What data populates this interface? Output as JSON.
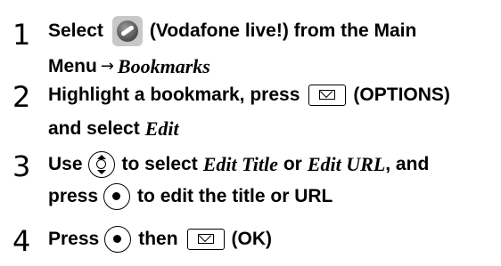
{
  "steps": [
    {
      "number": "1",
      "line1": {
        "a": "Select",
        "b": "(Vodafone live!) from the Main"
      },
      "line2": {
        "a": "Menu",
        "arrow": "→",
        "b": "Bookmarks"
      },
      "icon": "vodafone-live-icon"
    },
    {
      "number": "2",
      "line1": {
        "a": "Highlight a bookmark, press",
        "b": "(OPTIONS)"
      },
      "line2": {
        "a": "and select",
        "b": "Edit"
      },
      "icon": "mail-key-icon"
    },
    {
      "number": "3",
      "line1": {
        "a": "Use",
        "b": "to select",
        "c": "Edit Title",
        "d": "or",
        "e": "Edit URL",
        "f": ", and"
      },
      "line2": {
        "a": "press",
        "b": "to edit the title or URL"
      },
      "icons": [
        "navigation-key-icon",
        "center-key-icon"
      ]
    },
    {
      "number": "4",
      "line1": {
        "a": "Press",
        "b": "then",
        "c": "(OK)"
      },
      "icons": [
        "center-key-icon",
        "mail-key-icon"
      ]
    }
  ]
}
